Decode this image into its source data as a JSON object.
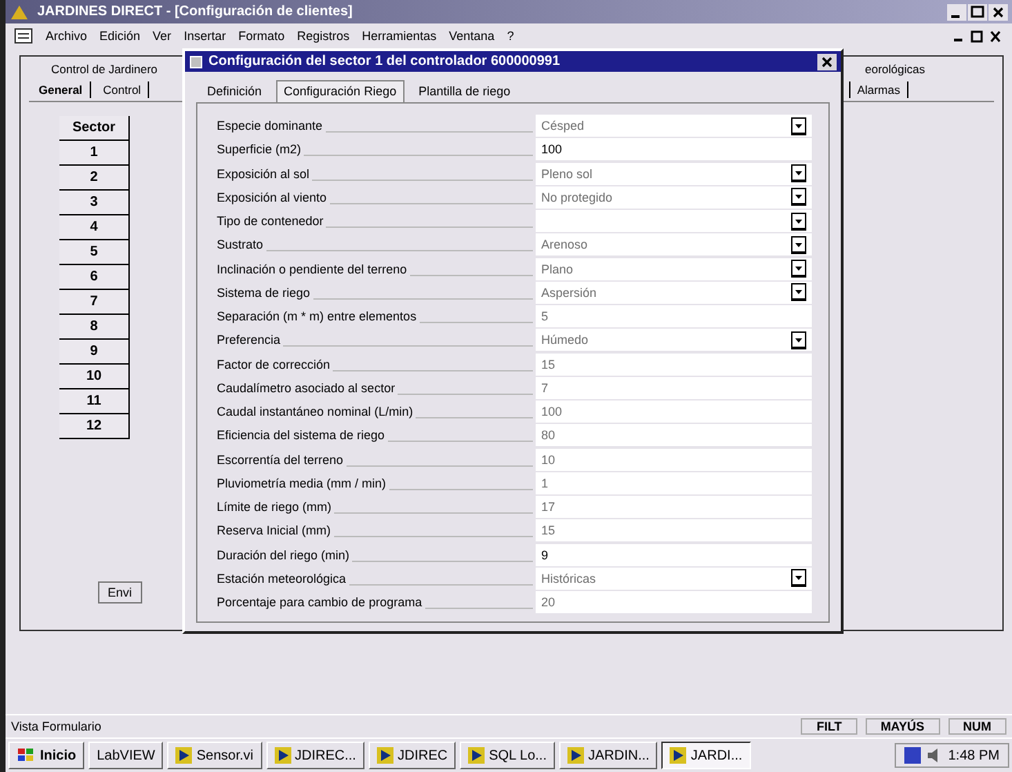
{
  "window": {
    "title": "JARDINES DIRECT - [Configuración de clientes]"
  },
  "menu": [
    "Archivo",
    "Edición",
    "Ver",
    "Insertar",
    "Formato",
    "Registros",
    "Herramientas",
    "Ventana",
    "?"
  ],
  "form": {
    "caption": "Control de Jardinero",
    "tabs": [
      {
        "label": "General",
        "selected": true
      },
      {
        "label": "Control",
        "selected": false
      }
    ],
    "right_caption": "eorológicas",
    "right_tab": "Alarmas",
    "grid_header": "Sector",
    "sectors": [
      "1",
      "2",
      "3",
      "4",
      "5",
      "6",
      "7",
      "8",
      "9",
      "10",
      "11",
      "12"
    ],
    "send_button": "Envi"
  },
  "dialog": {
    "title": "Configuración del sector 1 del controlador 600000991",
    "tabs": [
      {
        "label": "Definición",
        "selected": false
      },
      {
        "label": "Configuración Riego",
        "selected": true
      },
      {
        "label": "Plantilla de riego",
        "selected": false
      }
    ],
    "fields": [
      {
        "label": "Especie dominante",
        "value": "Césped",
        "disabled": true,
        "dropdown": true
      },
      {
        "label": "Superficie (m2)",
        "value": "100",
        "disabled": false,
        "dropdown": false
      },
      {
        "label": "Exposición al sol",
        "value": "Pleno sol",
        "disabled": true,
        "dropdown": true
      },
      {
        "label": "Exposición al viento",
        "value": "No protegido",
        "disabled": true,
        "dropdown": true
      },
      {
        "label": "Tipo de contenedor",
        "disabled": true,
        "dropdown": true
      },
      {
        "label": "Sustrato",
        "value": "Arenoso",
        "disabled": true,
        "dropdown": true
      },
      {
        "label": "Inclinación o pendiente del terreno",
        "value": "Plano",
        "disabled": true,
        "dropdown": true
      },
      {
        "label": "Sistema de riego",
        "value": "Aspersión",
        "disabled": true,
        "dropdown": true
      },
      {
        "label": "Separación (m * m) entre elementos",
        "value": "5",
        "disabled": true,
        "dropdown": false
      },
      {
        "label": "Preferencia",
        "value": "Húmedo",
        "disabled": true,
        "dropdown": true
      },
      {
        "label": "Factor de corrección",
        "value": "15",
        "disabled": true,
        "dropdown": false
      },
      {
        "label": "Caudalímetro asociado al sector",
        "value": "7",
        "disabled": true,
        "dropdown": false
      },
      {
        "label": "Caudal instantáneo nominal (L/min)",
        "value": "100",
        "disabled": true,
        "dropdown": false
      },
      {
        "label": "Eficiencia del sistema de riego",
        "value": "80",
        "disabled": true,
        "dropdown": false
      },
      {
        "label": "Escorrentía del terreno",
        "value": "10",
        "disabled": true,
        "dropdown": false
      },
      {
        "label": "Pluviometría media (mm / min)",
        "value": "1",
        "disabled": true,
        "dropdown": false
      },
      {
        "label": "Límite de riego (mm)",
        "value": "17",
        "disabled": true,
        "dropdown": false
      },
      {
        "label": "Reserva Inicial (mm)",
        "value": "15",
        "disabled": true,
        "dropdown": false
      },
      {
        "label": "Duración del riego (min)",
        "value": "9",
        "disabled": false,
        "dropdown": false
      },
      {
        "label": "Estación meteorológica",
        "value": "Históricas",
        "disabled": true,
        "dropdown": true
      },
      {
        "label": "Porcentaje para cambio de programa",
        "value": "20",
        "disabled": true,
        "dropdown": false
      }
    ]
  },
  "status_bar": {
    "text": "Vista Formulario",
    "indicators": [
      "FILT",
      "MAYÚS",
      "NUM"
    ]
  },
  "taskbar": {
    "start": "Inicio",
    "buttons": [
      {
        "label": "LabVIEW",
        "selected": false,
        "icon": false
      },
      {
        "label": "Sensor.vi",
        "selected": false,
        "icon": true
      },
      {
        "label": "JDIREC...",
        "selected": false,
        "icon": true
      },
      {
        "label": "JDIREC",
        "selected": false,
        "icon": true
      },
      {
        "label": "SQL Lo...",
        "selected": false,
        "icon": true
      },
      {
        "label": "JARDIN...",
        "selected": false,
        "icon": true
      },
      {
        "label": "JARDI...",
        "selected": true,
        "icon": true
      }
    ],
    "clock": "1:48 PM"
  }
}
